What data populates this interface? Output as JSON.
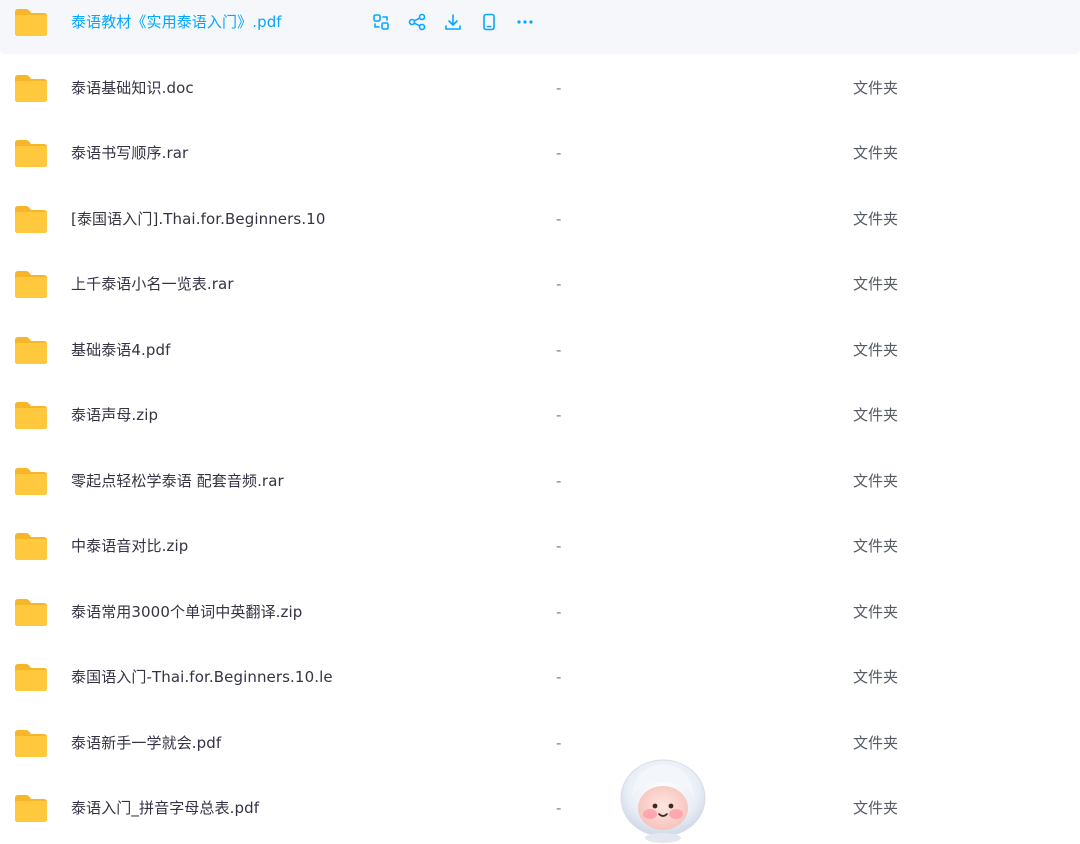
{
  "files": [
    {
      "name": "泰语教材《实用泰语入门》.pdf",
      "size": "",
      "type": ""
    },
    {
      "name": "泰语基础知识.doc",
      "size": "-",
      "type": "文件夹"
    },
    {
      "name": "泰语书写顺序.rar",
      "size": "-",
      "type": "文件夹"
    },
    {
      "name": "[泰国语入门].Thai.for.Beginners.10",
      "size": "-",
      "type": "文件夹"
    },
    {
      "name": "上千泰语小名一览表.rar",
      "size": "-",
      "type": "文件夹"
    },
    {
      "name": "基础泰语4.pdf",
      "size": "-",
      "type": "文件夹"
    },
    {
      "name": "泰语声母.zip",
      "size": "-",
      "type": "文件夹"
    },
    {
      "name": "零起点轻松学泰语 配套音频.rar",
      "size": "-",
      "type": "文件夹"
    },
    {
      "name": "中泰语音对比.zip",
      "size": "-",
      "type": "文件夹"
    },
    {
      "name": "泰语常用3000个单词中英翻译.zip",
      "size": "-",
      "type": "文件夹"
    },
    {
      "name": "泰国语入门-Thai.for.Beginners.10.le",
      "size": "-",
      "type": "文件夹"
    },
    {
      "name": "泰语新手一学就会.pdf",
      "size": "-",
      "type": "文件夹"
    },
    {
      "name": "泰语入门_拼音字母总表.pdf",
      "size": "-",
      "type": "文件夹"
    }
  ],
  "hover_actions": [
    "transfer-icon",
    "share-icon",
    "download-icon",
    "phone-icon",
    "more-icon"
  ],
  "colors": {
    "accent": "#06a7ff",
    "folder": "#ffc83d",
    "hover_bg": "#f5f7fb"
  }
}
